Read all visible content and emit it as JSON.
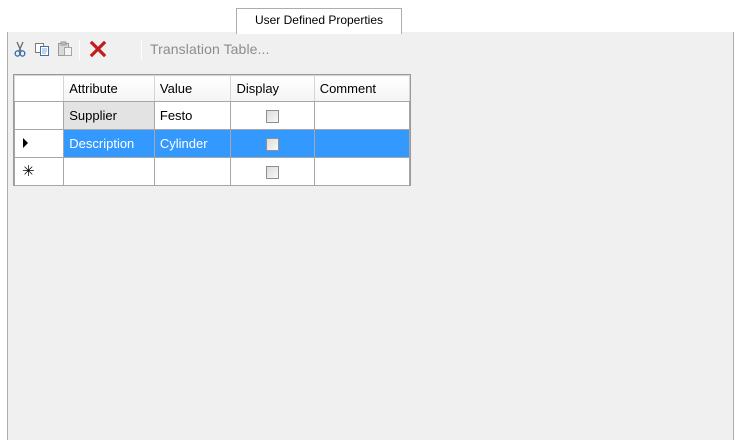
{
  "tab": {
    "label": "User Defined Properties"
  },
  "toolbar": {
    "cut_icon": "scissors-icon",
    "copy_icon": "copy-icon",
    "paste_icon": "paste-icon",
    "delete_icon": "delete-x-icon",
    "translation_table_label": "Translation Table..."
  },
  "grid": {
    "columns": [
      "Attribute",
      "Value",
      "Display",
      "Comment"
    ],
    "rows": [
      {
        "attribute": "Supplier",
        "value": "Festo",
        "display": false,
        "comment": ""
      },
      {
        "attribute": "Description",
        "value": "Cylinder",
        "display": false,
        "comment": "",
        "selected": true
      },
      {
        "attribute": "",
        "value": "",
        "display": false,
        "comment": "",
        "new_row": true
      }
    ],
    "new_row_marker": "✳"
  },
  "colors": {
    "selection": "#3399ff",
    "panel": "#f0f0f0",
    "delete": "#c41c1c"
  }
}
